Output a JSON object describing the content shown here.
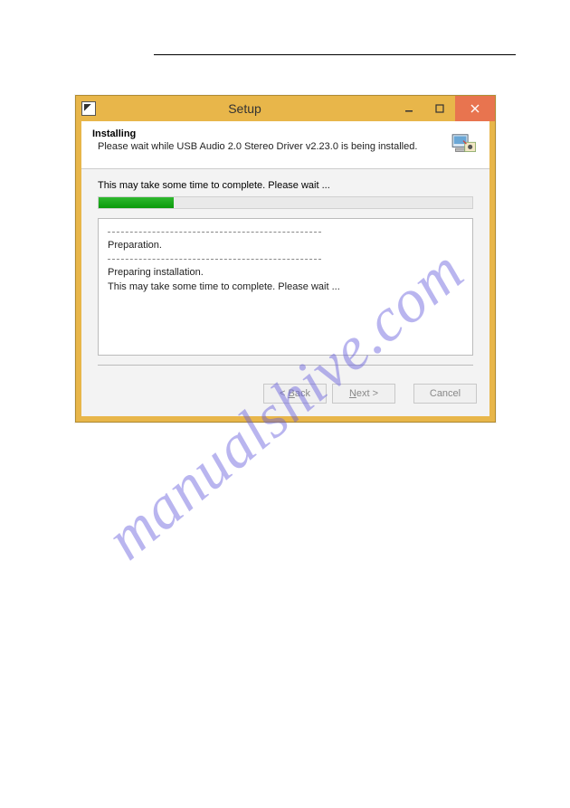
{
  "watermark": "manualshive.com",
  "window": {
    "title": "Setup",
    "header": {
      "title": "Installing",
      "subtitle": "Please wait while USB Audio 2.0 Stereo Driver v2.23.0 is being installed."
    },
    "progress": {
      "label": "This may take some time to complete. Please wait ...",
      "percent": 20
    },
    "log": {
      "line1": "Preparation.",
      "line2": "Preparing installation.",
      "line3": "This may take some time to complete. Please wait ..."
    },
    "buttons": {
      "back": "< Back",
      "next": "Next >",
      "cancel": "Cancel"
    }
  }
}
